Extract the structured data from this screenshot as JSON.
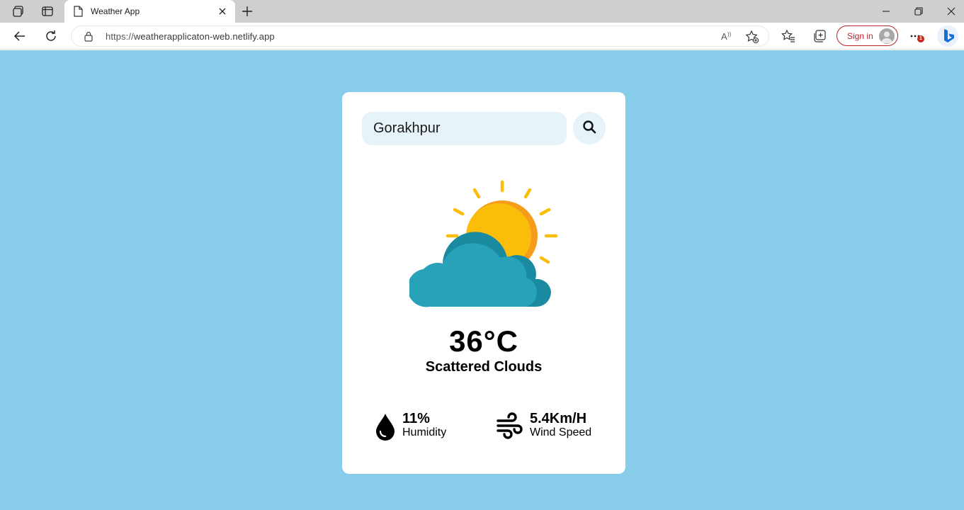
{
  "browser": {
    "tab": {
      "title": "Weather App"
    },
    "address": {
      "protocol": "https://",
      "host": "weatherapplicaton-web.netlify.app"
    },
    "signin_label": "Sign in",
    "notification_badge": "1"
  },
  "app": {
    "search": {
      "value": "Gorakhpur"
    },
    "weather": {
      "icon": "sun-behind-cloud",
      "temperature": "36°C",
      "condition": "Scattered Clouds"
    },
    "details": {
      "humidity": {
        "value": "11%",
        "label": "Humidity"
      },
      "wind": {
        "value": "5.4Km/H",
        "label": "Wind Speed"
      }
    }
  },
  "colors": {
    "background": "#87cdea",
    "card": "#ffffff",
    "input_bg": "#e6f3f9",
    "sun": "#f9bd0a",
    "sun_shade": "#f69c1c",
    "cloud": "#27a2b9",
    "cloud_shade": "#1a8aa0",
    "signin_accent": "#b8262b"
  }
}
